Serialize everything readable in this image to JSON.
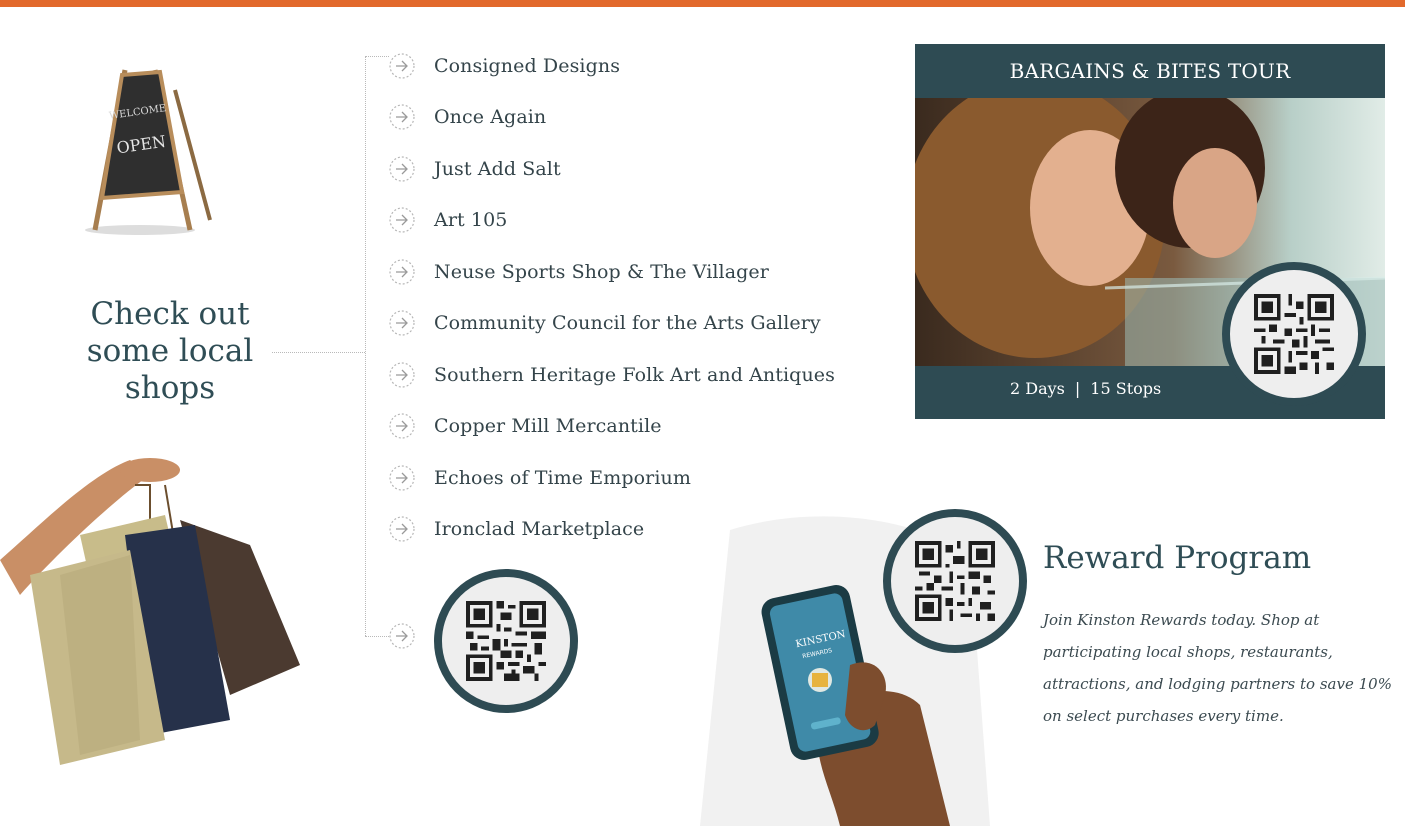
{
  "colors": {
    "accent": "#e2692c",
    "teal": "#2e4b53",
    "text": "#34444a"
  },
  "headline": [
    "Check out",
    "some local",
    "shops"
  ],
  "shops": [
    "Consigned Designs",
    "Once Again",
    "Just Add Salt",
    "Art 105",
    "Neuse Sports Shop & The Villager",
    "Community Council for the Arts Gallery",
    "Southern Heritage Folk Art and Antiques",
    "Copper Mill Mercantile",
    "Echoes of Time Emporium",
    "Ironclad Marketplace"
  ],
  "icons": {
    "list_arrow": "circle-arrow-icon",
    "qr": "qr-code-icon"
  },
  "sign": {
    "lines": [
      "WELCOME",
      "OPEN"
    ]
  },
  "tour": {
    "title": "BARGAINS & BITES TOUR",
    "days": "2 Days",
    "separator": "|",
    "stops": "15 Stops"
  },
  "phone": {
    "app_name": "KINSTON",
    "app_sub": "REWARDS"
  },
  "reward": {
    "title": "Reward Program",
    "description": "Join Kinston Rewards today. Shop at participating local shops, restaurants, attractions, and lodging partners to save 10% on select purchases every time."
  }
}
